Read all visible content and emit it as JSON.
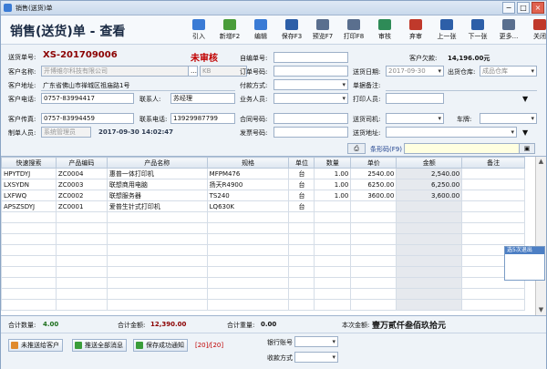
{
  "window": {
    "title": "销售(送货)单"
  },
  "header": {
    "doc_title": "销售(送货)单 - 查看",
    "toolbar": [
      {
        "label": "引入",
        "icon": "import-icon",
        "color": "#3a7bd5"
      },
      {
        "label": "新增F2",
        "icon": "new-icon",
        "color": "#4a9d3a"
      },
      {
        "label": "编辑",
        "icon": "edit-icon",
        "color": "#3a7bd5"
      },
      {
        "label": "保存F3",
        "icon": "save-icon",
        "color": "#2d5fa8"
      },
      {
        "label": "预览F7",
        "icon": "preview-icon",
        "color": "#5a6f8e"
      },
      {
        "label": "打印F8",
        "icon": "print-icon",
        "color": "#5a6f8e"
      },
      {
        "label": "审核",
        "icon": "approve-icon",
        "color": "#2e8b57"
      },
      {
        "label": "弃审",
        "icon": "unapprove-icon",
        "color": "#c0392b"
      },
      {
        "label": "上一张",
        "icon": "prev-icon",
        "color": "#2d5fa8"
      },
      {
        "label": "下一张",
        "icon": "next-icon",
        "color": "#2d5fa8"
      },
      {
        "label": "更多...",
        "icon": "more-icon",
        "color": "#5a6f8e"
      },
      {
        "label": "关闭",
        "icon": "close-icon",
        "color": "#c0392b"
      }
    ]
  },
  "form": {
    "doc_no_label": "送货单号:",
    "doc_no": "XS-201709006",
    "status": "未审核",
    "self_no_label": "自编单号:",
    "self_no": "",
    "owed_label": "客户欠款:",
    "owed": "14,196.00元",
    "customer_label": "客户名称:",
    "customer": "开博维尔科技有限公司",
    "customer_code": "KB",
    "order_no_label": "订单号码:",
    "order_no": "",
    "delivery_date_label": "送货日期:",
    "delivery_date": "2017-09-30",
    "warehouse_label": "出货仓库:",
    "warehouse": "成品仓库",
    "address_label": "客户地址:",
    "address": "广东省佛山市禅城区祖庙路1号",
    "pay_method_label": "付款方式:",
    "pay_method": "",
    "remark_label": "单据备注:",
    "remark": "",
    "phone_label": "客户电话:",
    "phone": "0757-83994417",
    "contact_label": "联系人:",
    "contact": "苏经理",
    "sales_label": "业务人员:",
    "sales": "",
    "printer_label": "打印人员:",
    "printer": "",
    "fax_label": "客户传真:",
    "fax": "0757-83994459",
    "contact_phone_label": "联系电话:",
    "contact_phone": "13929987799",
    "contract_label": "合同号码:",
    "contract": "",
    "delivery_car_label": "送货司机:",
    "delivery_car": "",
    "plate_label": "车牌:",
    "plate": "",
    "maker_label": "制单人员:",
    "maker": "系统管理员",
    "made_time": "2017-09-30 14:02:47",
    "invoice_label": "发票号码:",
    "invoice": "",
    "delivery_addr_label": "送货地址:",
    "delivery_addr": "",
    "barcode_label": "条形码(F9)"
  },
  "grid": {
    "columns": [
      "快速搜索",
      "产品编码",
      "产品名称",
      "规格",
      "单位",
      "数量",
      "单价",
      "金额",
      "备注"
    ],
    "rows": [
      [
        "HPYTDYJ",
        "ZC0004",
        "惠普一体打印机",
        "MFPM476",
        "台",
        "1.00",
        "2540.00",
        "2,540.00",
        ""
      ],
      [
        "LXSYDN",
        "ZC0003",
        "联想商用电脑",
        "扬天R4900",
        "台",
        "1.00",
        "6250.00",
        "6,250.00",
        ""
      ],
      [
        "LXFWQ",
        "ZC0002",
        "联想服务器",
        "TS240",
        "台",
        "1.00",
        "3600.00",
        "3,600.00",
        ""
      ],
      [
        "APSZSDYJ",
        "ZC0001",
        "爱普生针式打印机",
        "LQ630K",
        "台",
        "",
        "",
        "",
        ""
      ]
    ],
    "popup_title": "选5次退出"
  },
  "totals": {
    "qty_label": "合计数量:",
    "qty": "4.00",
    "amount_label": "合计金额:",
    "amount": "12,390.00",
    "weight_label": "合计重量:",
    "weight": "0.00",
    "discount_label": "本次金额:",
    "discount_value": "壹万贰仟叁佰玖拾元"
  },
  "bottom": {
    "btn1": "未推送给客户",
    "btn2": "推送全部消息",
    "btn3": "保存成功通知",
    "counter": "[20]/[20]",
    "bank_label": "银行账号",
    "receive_label": "收款方式"
  }
}
